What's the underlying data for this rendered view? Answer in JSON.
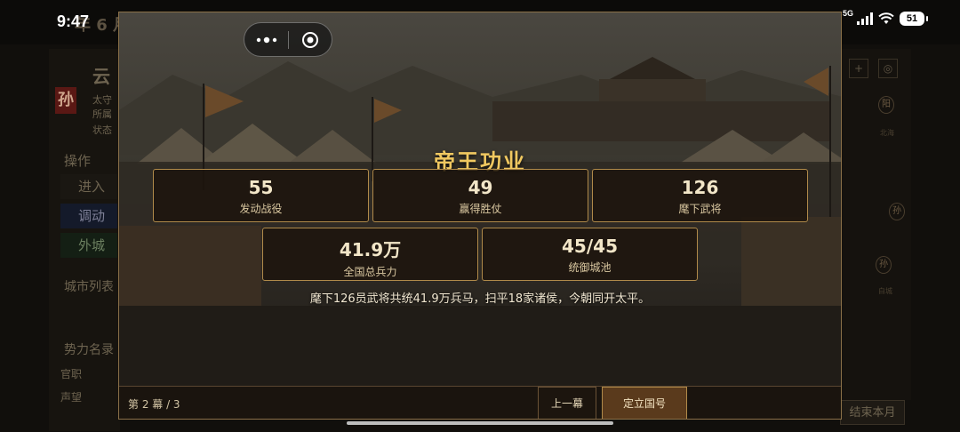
{
  "status_bar": {
    "time": "9:47",
    "network": "5G",
    "battery": "51"
  },
  "background": {
    "date_partial": "年 6 月",
    "city_initial": "云",
    "faction_char": "孙",
    "info_lines": [
      "太守",
      "所属",
      "状态"
    ],
    "section_ops": "操作",
    "buttons": [
      "进入",
      "调动",
      "外城"
    ],
    "section_city_list": "城市列表",
    "section_faction": "势力名录",
    "faction_rows": [
      "官职",
      "声望"
    ],
    "map_tags": [
      "阳",
      "孙",
      "孙"
    ],
    "map_labels": [
      "北海",
      "白城"
    ],
    "end_turn": "结束本月"
  },
  "modal": {
    "title": "帝王功业",
    "stats": [
      {
        "value": "55",
        "label": "发动战役"
      },
      {
        "value": "49",
        "label": "赢得胜仗"
      },
      {
        "value": "126",
        "label": "麾下武将"
      },
      {
        "value": "41.9万",
        "label": "全国总兵力"
      },
      {
        "value": "45/45",
        "label": "统御城池"
      }
    ],
    "summary": "麾下126员武将共统41.9万兵马，扫平18家诸侯，今朝同开太平。",
    "page_indicator": "第 2 幕 / 3",
    "prev_label": "上一幕",
    "confirm_label": "定立国号"
  }
}
